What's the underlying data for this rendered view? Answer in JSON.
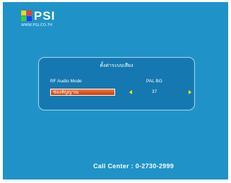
{
  "logo": {
    "brand": "PSI",
    "url": "WWW.PSI.CO.TH"
  },
  "dialog": {
    "title": "ตั้งค่าระบบเสียง",
    "rows": [
      {
        "label": "RF Audio Mode",
        "value": "PAL BG"
      },
      {
        "label": "ช่องสัญญาณ",
        "value": "37"
      }
    ]
  },
  "footer": {
    "call_center": "Call Center : 0-2730-2999"
  },
  "colors": {
    "background": "#1f93c8",
    "dialog_bg": "#1678b0",
    "selection": "#e4501a",
    "arrow": "#ffe81a",
    "text": "#ffffff"
  },
  "icons": {
    "logo": "psi-logo-icon",
    "left": "arrow-left-icon",
    "right": "arrow-right-icon"
  }
}
